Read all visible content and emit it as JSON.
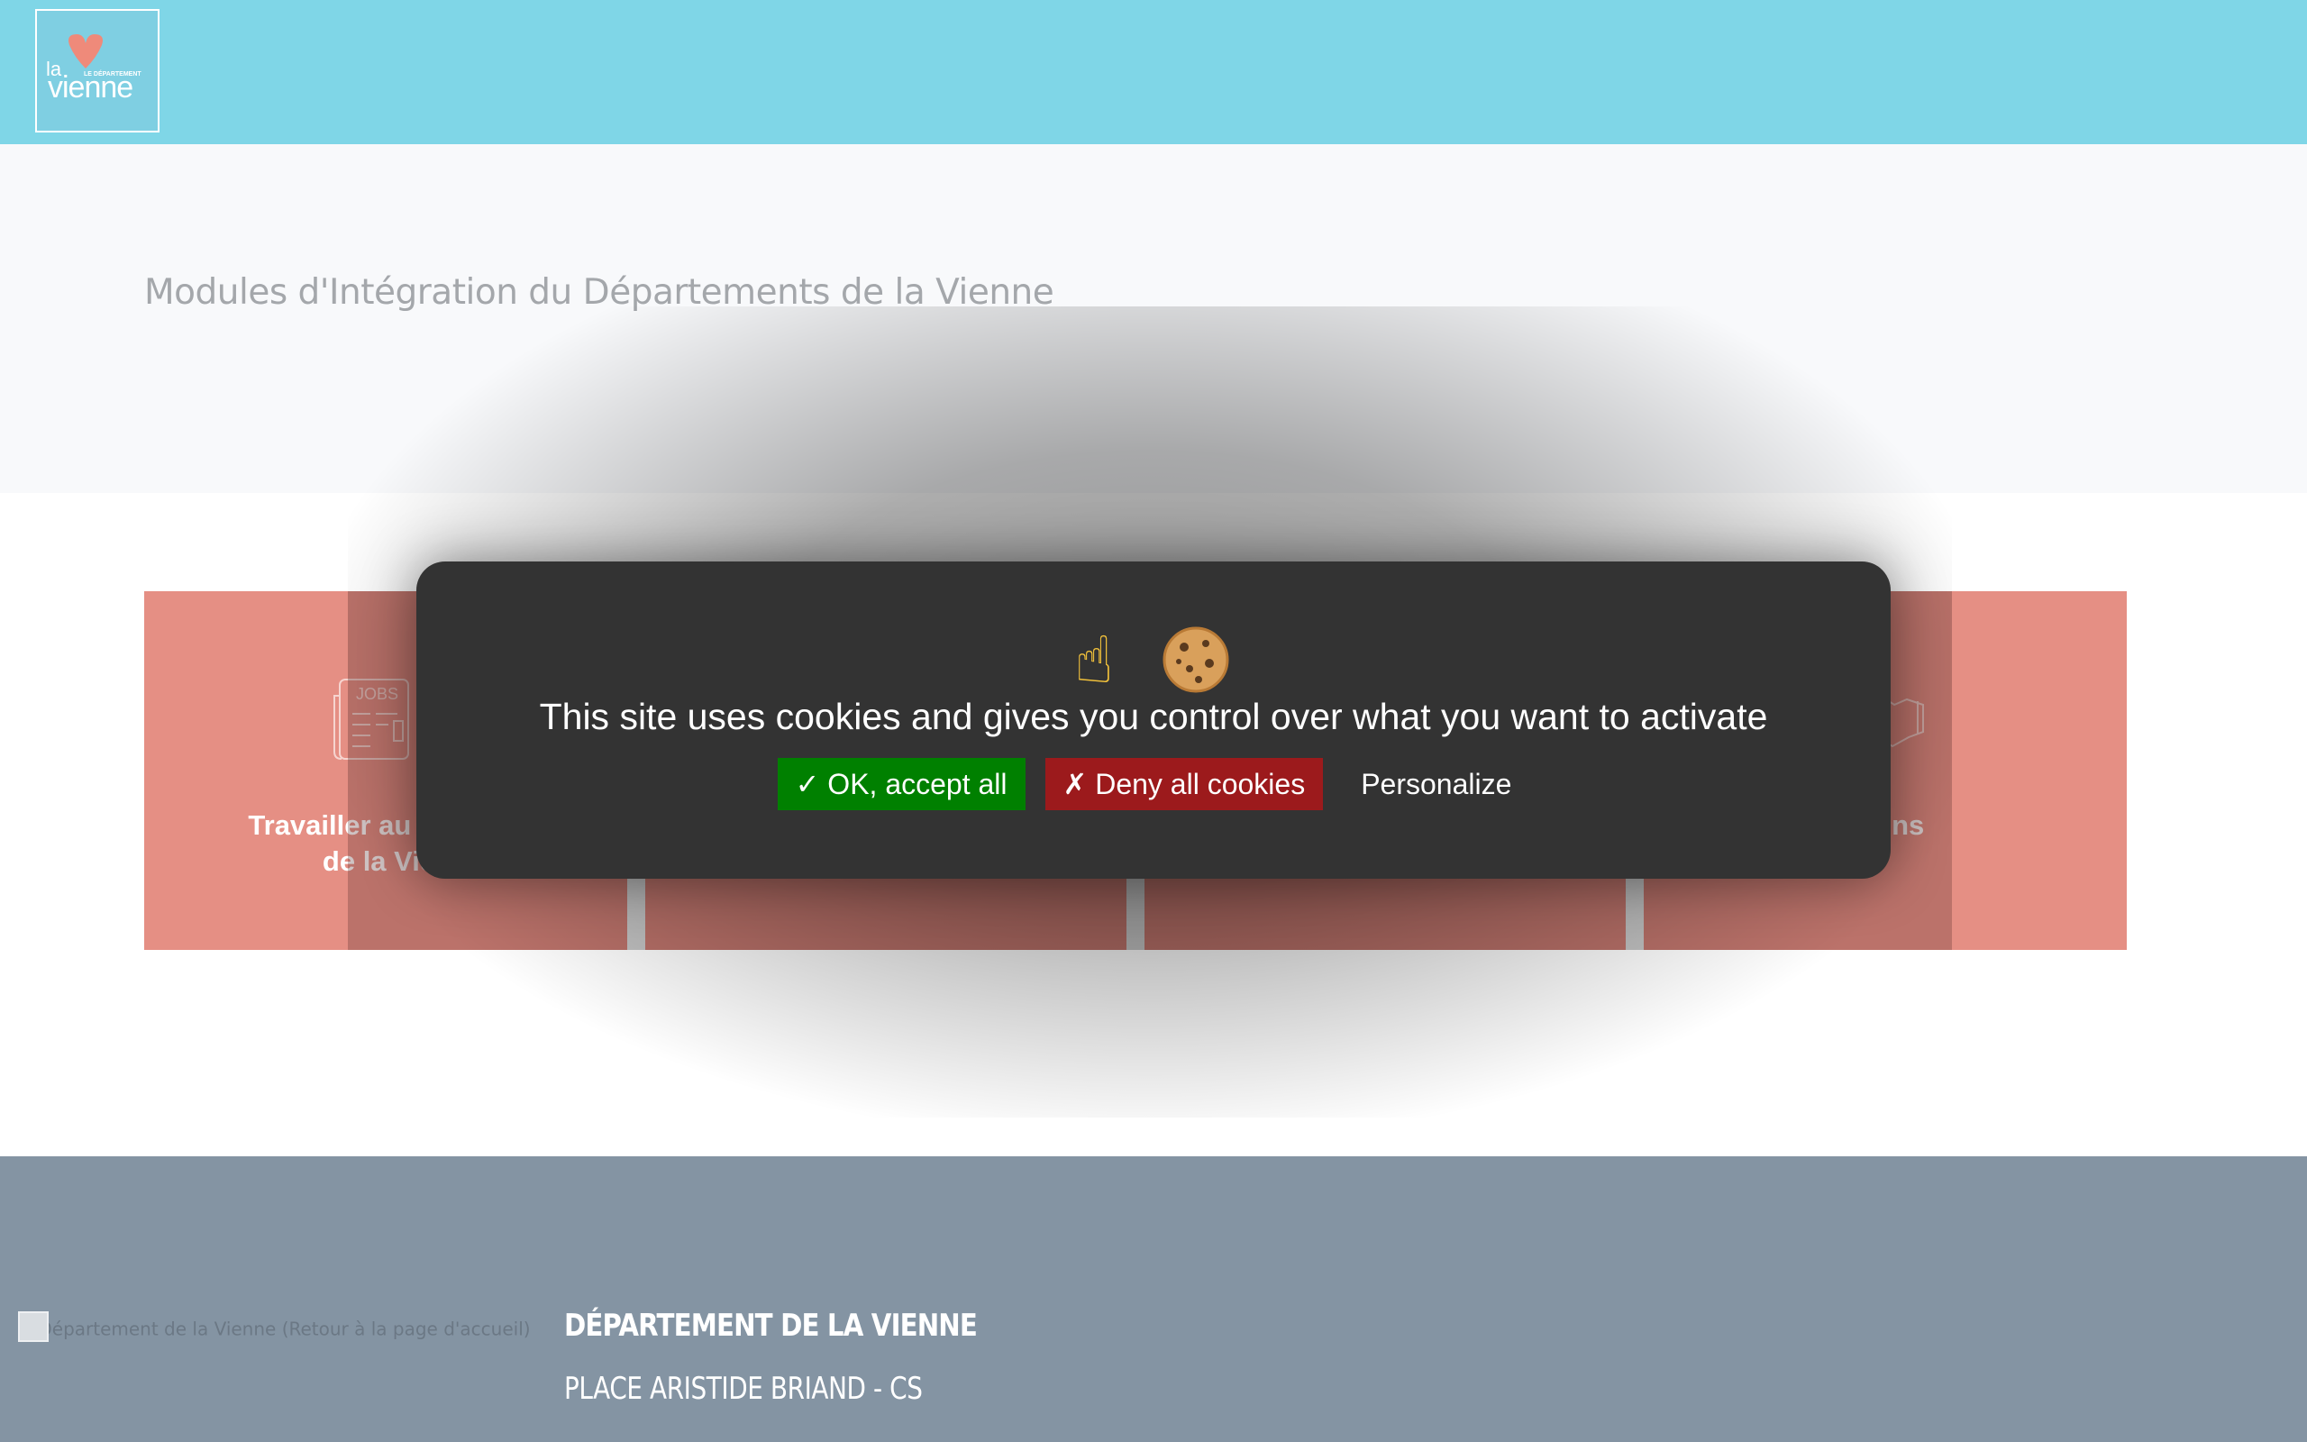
{
  "header": {
    "logo": {
      "alt": "la Vienne - Le Département",
      "small_text": "la",
      "dept_text": "LE DÉPARTEMENT",
      "name_text": "vienne"
    }
  },
  "intro": {
    "title": "Modules d'Intégration du Départements de la Vienne"
  },
  "tiles": [
    {
      "label_line1": "Travailler au Dé",
      "label_line2": "de la Vien",
      "icon": "jobs-newspaper-icon",
      "icon_text": "JOBS"
    },
    {
      "label_line1": "",
      "label_line2": "",
      "icon": ""
    },
    {
      "label_line1": "",
      "label_line2": "",
      "icon": ""
    },
    {
      "label_line1": "ations",
      "label_line2": "",
      "icon": "handshake-icon"
    }
  ],
  "cookie_banner": {
    "emoji": "☝",
    "message": "This site uses cookies and gives you control over what you want to activate",
    "accept_label": "✓ OK, accept all",
    "deny_label": "✗ Deny all cookies",
    "personalize_label": "Personalize"
  },
  "footer": {
    "logo_alt": "Département de la Vienne (Retour à la page d'accueil)",
    "org_name": "DÉPARTEMENT DE LA VIENNE",
    "address": "PLACE ARISTIDE BRIAND - CS"
  },
  "colors": {
    "header_bg": "#7fd6e7",
    "tile_bg": "#e58f84",
    "banner_bg": "#333333",
    "accept_bg": "#008000",
    "deny_bg": "#9c1a1c",
    "footer_bg": "#8494a3"
  }
}
